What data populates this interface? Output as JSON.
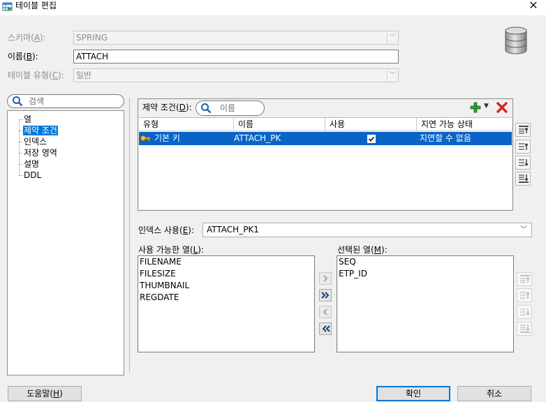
{
  "window": {
    "title": "테이블 편집",
    "close_glyph": "✕"
  },
  "form": {
    "schema_label": "스키마(A):",
    "schema_value": "SPRING",
    "name_label": "이름(B):",
    "name_value": "ATTACH",
    "type_label": "테이블 유형(C):",
    "type_value": "일반"
  },
  "nav": {
    "search_placeholder": "검색",
    "items": [
      {
        "label": "열"
      },
      {
        "label": "제약 조건"
      },
      {
        "label": "인덱스"
      },
      {
        "label": "저장 영역"
      },
      {
        "label": "설명"
      },
      {
        "label": "DDL"
      }
    ],
    "selected": "제약 조건"
  },
  "constraints": {
    "label": "제약 조건(D):",
    "search_placeholder": "이름",
    "columns": [
      "유형",
      "이름",
      "사용",
      "지연 가능 상태"
    ],
    "rows": [
      {
        "type": "기본 키",
        "name": "ATTACH_PK",
        "enabled": true,
        "deferrable": "지연할 수 없음"
      }
    ]
  },
  "index": {
    "label": "인덱스 사용(E):",
    "value": "ATTACH_PK1",
    "available_label": "사용 가능한 열(L):",
    "available": [
      "FILENAME",
      "FILESIZE",
      "THUMBNAIL",
      "REGDATE"
    ],
    "selected_label": "선택된 열(M):",
    "selected": [
      "SEQ",
      "ETP_ID"
    ]
  },
  "buttons": {
    "help": "도움말(H)",
    "ok": "확인",
    "cancel": "취소"
  },
  "colors": {
    "selection": "#0a64c8",
    "window_bg": "#f0f0f0",
    "accent": "#0078d7"
  },
  "icons": [
    "table-edit-icon",
    "close-icon",
    "database-icon",
    "search-icon",
    "add-icon",
    "dropdown-arrow-icon",
    "delete-icon",
    "primary-key-icon",
    "move-top-icon",
    "move-up-icon",
    "move-down-icon",
    "move-bottom-icon",
    "move-right-icon",
    "move-all-right-icon",
    "move-left-icon",
    "move-all-left-icon"
  ]
}
